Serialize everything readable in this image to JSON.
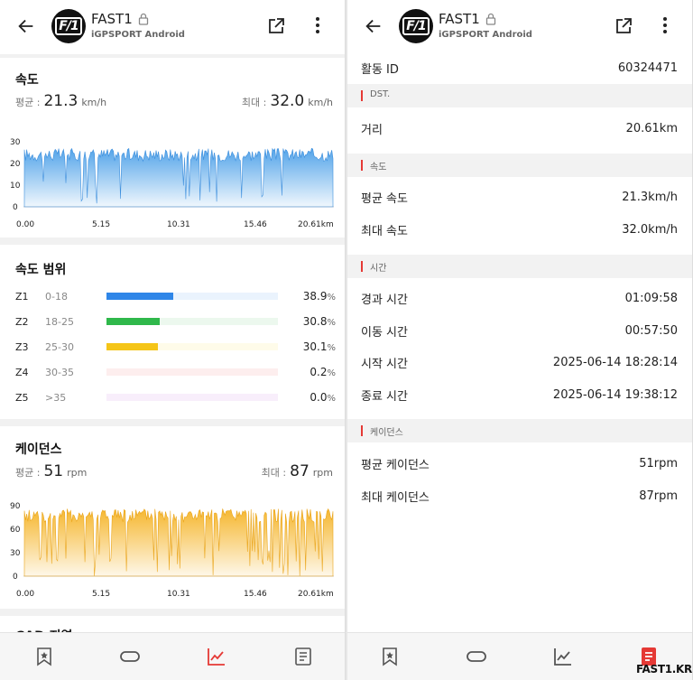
{
  "header": {
    "app_title": "FAST1",
    "app_subtitle": "iGPSPORT Android",
    "logo_text": "F/1"
  },
  "left": {
    "speed_card": {
      "title": "속도",
      "avg_label": "평균 :",
      "avg_value": "21.3",
      "avg_unit": "km/h",
      "max_label": "최대 :",
      "max_value": "32.0",
      "max_unit": "km/h"
    },
    "speed_chart": {
      "y_ticks": [
        "30",
        "20",
        "10",
        "0"
      ],
      "x_ticks": [
        "0.00",
        "5.15",
        "10.31",
        "15.46",
        "20.61km"
      ],
      "color": "#4a9fe8"
    },
    "zones_card": {
      "title": "속도 범위",
      "zones": [
        {
          "id": "Z1",
          "range": "0-18",
          "pct": "38.9",
          "pct_unit": "%",
          "color": "#2f86e8",
          "track": "#eaf3fd",
          "fill_fraction": 0.389
        },
        {
          "id": "Z2",
          "range": "18-25",
          "pct": "30.8",
          "pct_unit": "%",
          "color": "#2fb84b",
          "track": "#ecf8ee",
          "fill_fraction": 0.308
        },
        {
          "id": "Z3",
          "range": "25-30",
          "pct": "30.1",
          "pct_unit": "%",
          "color": "#f5c518",
          "track": "#fefbe9",
          "fill_fraction": 0.301
        },
        {
          "id": "Z4",
          "range": "30-35",
          "pct": "0.2",
          "pct_unit": "%",
          "color": "#f08080",
          "track": "#fdeeee",
          "fill_fraction": 0.002
        },
        {
          "id": "Z5",
          "range": ">35",
          "pct": "0.0",
          "pct_unit": "%",
          "color": "#d59ee6",
          "track": "#f8eefb",
          "fill_fraction": 0.0
        }
      ]
    },
    "cadence_card": {
      "title": "케이던스",
      "avg_label": "평균 :",
      "avg_value": "51",
      "avg_unit": "rpm",
      "max_label": "최대 :",
      "max_value": "87",
      "max_unit": "rpm"
    },
    "cadence_chart": {
      "y_ticks": [
        "90",
        "60",
        "30",
        "0"
      ],
      "x_ticks": [
        "0.00",
        "5.15",
        "10.31",
        "15.46",
        "20.61km"
      ],
      "color": "#f5b324"
    },
    "next_card_title": "CAD 지역"
  },
  "right": {
    "activity_id_label": "활동 ID",
    "activity_id_value": "60324471",
    "sections": [
      {
        "label": "DST."
      },
      {
        "label": "속도"
      },
      {
        "label": "시간"
      },
      {
        "label": "케이던스"
      }
    ],
    "distance": {
      "label": "거리",
      "value": "20.61km"
    },
    "avg_speed": {
      "label": "평균 속도",
      "value": "21.3km/h"
    },
    "max_speed": {
      "label": "최대 속도",
      "value": "32.0km/h"
    },
    "elapsed": {
      "label": "경과 시간",
      "value": "01:09:58"
    },
    "moving": {
      "label": "이동 시간",
      "value": "00:57:50"
    },
    "start": {
      "label": "시작 시간",
      "value": "2025-06-14 18:28:14"
    },
    "end": {
      "label": "종료 시간",
      "value": "2025-06-14 19:38:12"
    },
    "avg_cad": {
      "label": "평균 케이던스",
      "value": "51rpm"
    },
    "max_cad": {
      "label": "최대 케이던스",
      "value": "87rpm"
    }
  },
  "nav": {
    "active_color": "#e53935",
    "inactive_color": "#555555"
  },
  "watermark": "FAST1.KR"
}
